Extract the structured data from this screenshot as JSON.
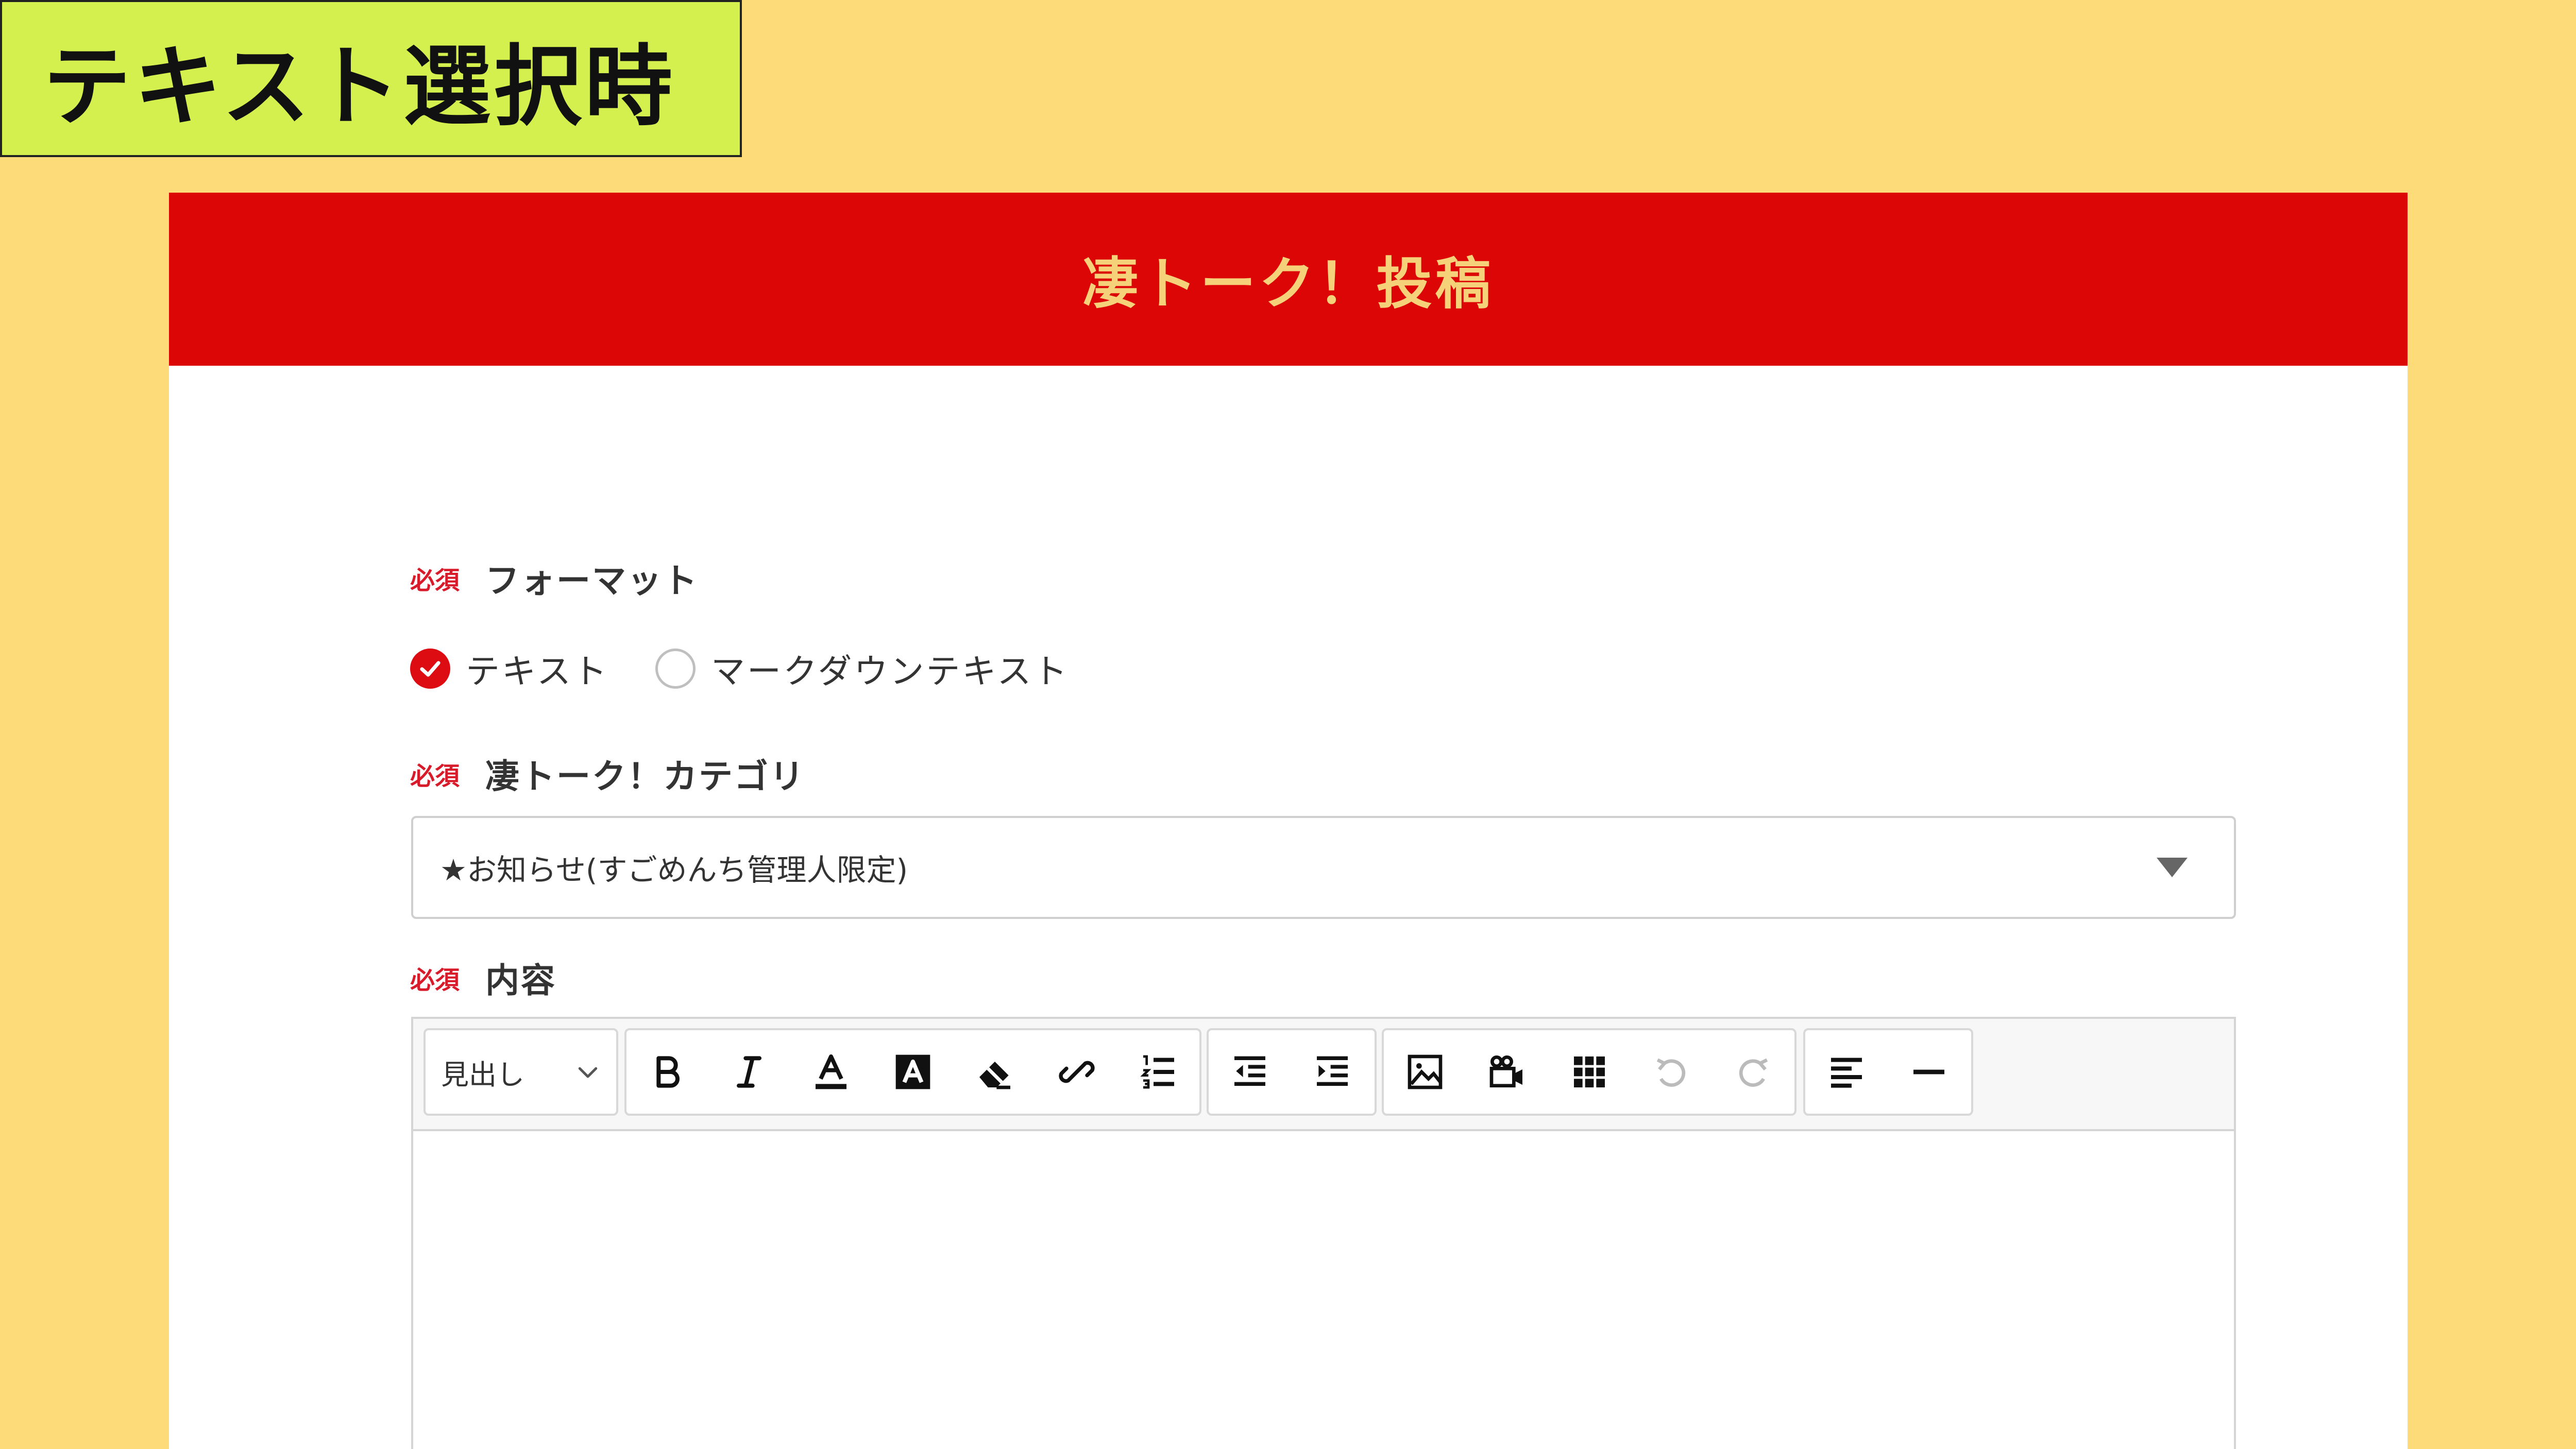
{
  "tag_label": "テキスト選択時",
  "header": {
    "title": "凄トーク！投稿"
  },
  "format": {
    "required": "必須",
    "label": "フォーマット",
    "options": [
      {
        "label": "テキスト",
        "selected": true
      },
      {
        "label": "マークダウンテキスト",
        "selected": false
      }
    ]
  },
  "category": {
    "required": "必須",
    "label": "凄トーク！カテゴリ",
    "selected_value": "★お知らせ(すごめんち管理人限定)"
  },
  "content": {
    "required": "必須",
    "label": "内容",
    "toolbar": {
      "heading_value": "見出し",
      "buttons": [
        "bold-icon",
        "italic-icon",
        "font-color-icon",
        "highlight-icon",
        "eraser-icon",
        "unlink-icon",
        "ordered-list-icon",
        "outdent-icon",
        "indent-icon",
        "image-icon",
        "video-icon",
        "table-icon",
        "undo-icon",
        "redo-icon",
        "align-left-icon",
        "horizontal-rule-icon"
      ]
    }
  },
  "colors": {
    "background": "#fddb78",
    "tag": "#d4f04e",
    "header": "#dc0606",
    "header_text": "#f5d27a",
    "required": "#d81b2a"
  }
}
